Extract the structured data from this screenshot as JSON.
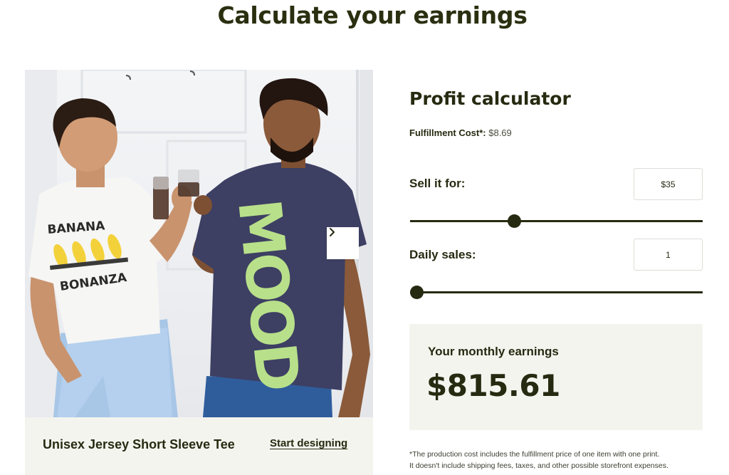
{
  "headline": "Calculate your earnings",
  "product": {
    "name": "Unisex Jersey Short Sleeve Tee",
    "cta": "Start designing",
    "photo": {
      "left_shirt_text_top": "BANANA",
      "left_shirt_text_bottom": "BONANZA",
      "right_shirt_text": "MOOD"
    },
    "next_icon": "chevron-right-icon"
  },
  "calculator": {
    "title": "Profit calculator",
    "fulfillment_label": "Fulfillment Cost*:",
    "fulfillment_value": "$8.69",
    "sell_label": "Sell it for:",
    "sell_value": "$35",
    "sell_slider_fraction": 0.35,
    "daily_label": "Daily sales:",
    "daily_value": "1",
    "daily_slider_fraction": 0.0,
    "earnings_label": "Your monthly earnings",
    "earnings_value": "$815.61",
    "disclaimer_line1": "*The production cost includes the fulfillment price of one item with one print.",
    "disclaimer_line2": "It doesn't include shipping fees, taxes, and other possible storefront expenses."
  },
  "colors": {
    "ink": "#262a10",
    "panel": "#f4f4ef",
    "shirt_navy": "#3d3f63",
    "shirt_text_green": "#b8e08a"
  }
}
